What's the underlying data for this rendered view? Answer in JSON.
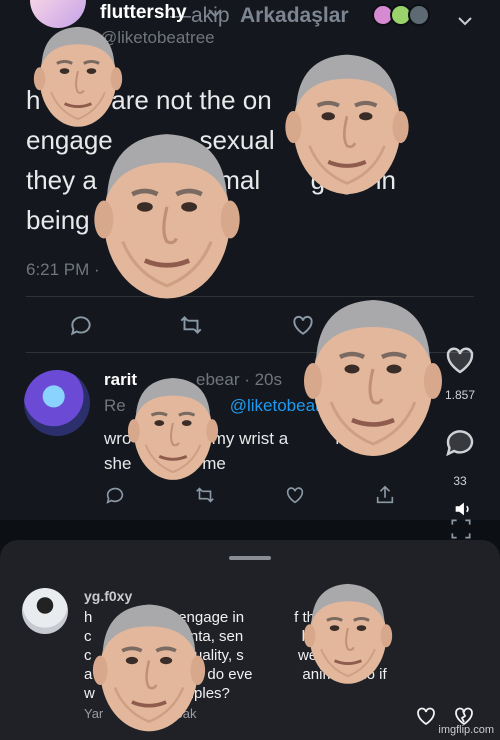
{
  "top_nav": {
    "following_label": "—akip",
    "friends_label": "Arkadaşlar"
  },
  "tweet": {
    "display_name": "fluttershy",
    "handle": "@liketobeatree",
    "text_lines": [
      "h       s are not the on       ",
      "engage            sexual       ut",
      "they a            animal       gage in",
      "being              e"
    ],
    "time": "6:21 PM ·"
  },
  "reply": {
    "name": "rarit",
    "handle_time": "ebear · 20s",
    "replying_prefix": "Re",
    "replying_to": "@liketobeat",
    "text_lines": [
      "wro            ed my wrist a          nd",
      "she            d me"
    ]
  },
  "rail": {
    "likes": "1.857",
    "comments": "33"
  },
  "comment": {
    "username": "yg.f0xy",
    "text_lines": [
      "h               lso engage in            f the sick",
      "c               placenta, sen              killing",
      "c               nosexuality, s             we only pick",
      "a               not just do eve            animals do if",
      "w               examples?"
    ],
    "meta": "Yar               ne bak"
  },
  "watermark": "imgflip.com",
  "colors": {
    "background": "#0c0f14",
    "tweet_bg": "#14171d",
    "mention": "#1d9bf0",
    "muted": "#71767b",
    "sheet_bg": "#1f2126"
  }
}
